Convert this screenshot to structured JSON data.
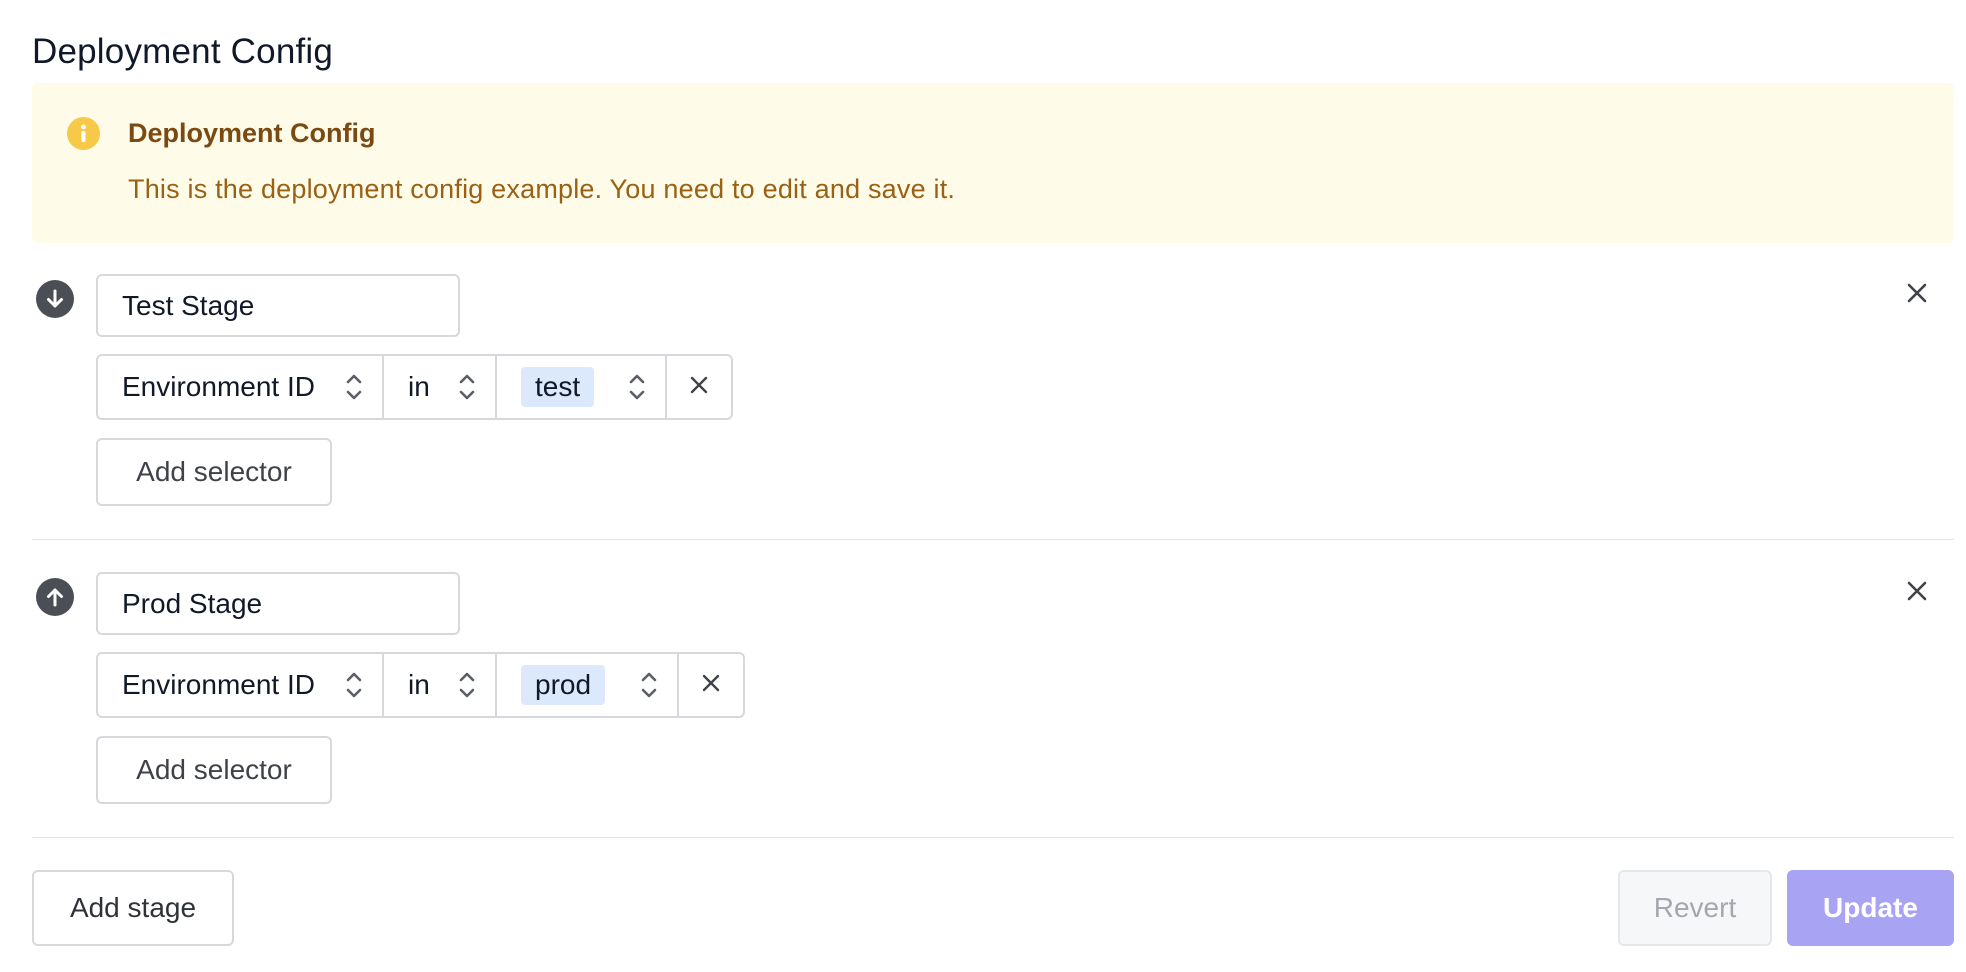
{
  "page": {
    "title": "Deployment Config"
  },
  "alert": {
    "title": "Deployment Config",
    "description": "This is the deployment config example. You need to edit and save it.",
    "icon": "info-icon",
    "colors": {
      "background": "#fefce8",
      "icon": "#f7c948",
      "title": "#7a4a12",
      "text": "#9a6114"
    }
  },
  "stages": [
    {
      "title": "Test Stage",
      "move_icon": "arrow-down-circle-icon",
      "selector": {
        "key": "Environment ID",
        "operator": "in",
        "values": [
          "test"
        ]
      },
      "add_selector_label": "Add selector"
    },
    {
      "title": "Prod Stage",
      "move_icon": "arrow-up-circle-icon",
      "selector": {
        "key": "Environment ID",
        "operator": "in",
        "values": [
          "prod"
        ]
      },
      "add_selector_label": "Add selector"
    }
  ],
  "footer": {
    "add_stage_label": "Add stage",
    "revert_label": "Revert",
    "update_label": "Update",
    "colors": {
      "update_background": "#a8a4f3",
      "tag_background": "#dce8fb"
    }
  }
}
